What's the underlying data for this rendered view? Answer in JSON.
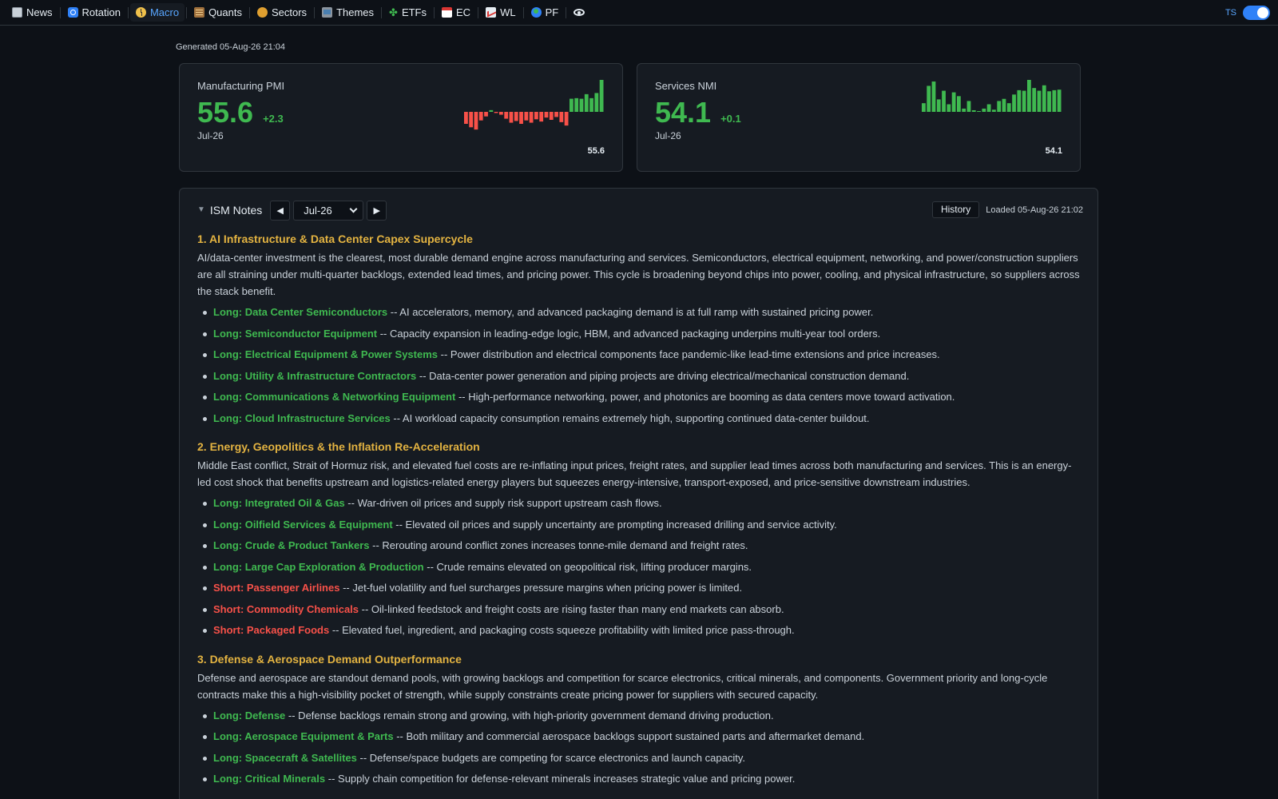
{
  "nav": {
    "items": [
      {
        "label": "News",
        "icon": "newspaper-icon"
      },
      {
        "label": "Rotation",
        "icon": "rotation-icon"
      },
      {
        "label": "Macro",
        "icon": "clock-icon",
        "active": true
      },
      {
        "label": "Quants",
        "icon": "abacus-icon"
      },
      {
        "label": "Sectors",
        "icon": "sectors-icon"
      },
      {
        "label": "Themes",
        "icon": "themes-icon"
      },
      {
        "label": "ETFs",
        "icon": "clover-icon"
      },
      {
        "label": "EC",
        "icon": "calendar-icon"
      },
      {
        "label": "WL",
        "icon": "chart-icon"
      },
      {
        "label": "PF",
        "icon": "globe-icon"
      }
    ],
    "ts_label": "TS"
  },
  "generated": "Generated 05-Aug-26 21:04",
  "cards": [
    {
      "title": "Manufacturing PMI",
      "value": "55.6",
      "change": "+2.3",
      "period": "Jul-26",
      "last": "55.6",
      "baseline": 50,
      "series": [
        47.9,
        47.3,
        46.9,
        48.5,
        49.2,
        50.3,
        49.8,
        49.5,
        48.8,
        48.1,
        48.4,
        47.9,
        48.5,
        48.1,
        48.7,
        48.3,
        49.0,
        48.6,
        49.1,
        48.2,
        47.6,
        52.3,
        52.4,
        52.3,
        53.1,
        52.4,
        53.3,
        55.6
      ],
      "colors": {
        "up": "#3fb950",
        "down": "#f85149"
      }
    },
    {
      "title": "Services NMI",
      "value": "54.1",
      "change": "+0.1",
      "period": "Jul-26",
      "last": "54.1",
      "baseline": 50,
      "series": [
        51.6,
        54.8,
        55.6,
        52.3,
        53.9,
        51.4,
        53.6,
        52.9,
        50.6,
        52.0,
        50.3,
        50.1,
        50.6,
        51.4,
        50.4,
        52.0,
        52.4,
        51.6,
        53.2,
        54.0,
        53.9,
        55.9,
        54.4,
        53.9,
        54.9,
        53.8,
        54.0,
        54.1
      ],
      "colors": {
        "up": "#3fb950",
        "down": "#f85149"
      }
    }
  ],
  "notes": {
    "title": "ISM Notes",
    "period": "Jul-26",
    "history_label": "History",
    "loaded": "Loaded 05-Aug-26 21:02",
    "sections": [
      {
        "title": "1. AI Infrastructure & Data Center Capex Supercycle",
        "desc": "AI/data-center investment is the clearest, most durable demand engine across manufacturing and services. Semiconductors, electrical equipment, networking, and power/construction suppliers are all straining under multi-quarter backlogs, extended lead times, and pricing power. This cycle is broadening beyond chips into power, cooling, and physical infrastructure, so suppliers across the stack benefit.",
        "items": [
          {
            "side": "long",
            "label": "Long: Data Center Semiconductors",
            "text": " -- AI accelerators, memory, and advanced packaging demand is at full ramp with sustained pricing power."
          },
          {
            "side": "long",
            "label": "Long: Semiconductor Equipment",
            "text": " -- Capacity expansion in leading-edge logic, HBM, and advanced packaging underpins multi-year tool orders."
          },
          {
            "side": "long",
            "label": "Long: Electrical Equipment & Power Systems",
            "text": " -- Power distribution and electrical components face pandemic-like lead-time extensions and price increases."
          },
          {
            "side": "long",
            "label": "Long: Utility & Infrastructure Contractors",
            "text": " -- Data-center power generation and piping projects are driving electrical/mechanical construction demand."
          },
          {
            "side": "long",
            "label": "Long: Communications & Networking Equipment",
            "text": " -- High-performance networking, power, and photonics are booming as data centers move toward activation."
          },
          {
            "side": "long",
            "label": "Long: Cloud Infrastructure Services",
            "text": " -- AI workload capacity consumption remains extremely high, supporting continued data-center buildout."
          }
        ]
      },
      {
        "title": "2. Energy, Geopolitics & the Inflation Re-Acceleration",
        "desc": "Middle East conflict, Strait of Hormuz risk, and elevated fuel costs are re-inflating input prices, freight rates, and supplier lead times across both manufacturing and services. This is an energy-led cost shock that benefits upstream and logistics-related energy players but squeezes energy-intensive, transport-exposed, and price-sensitive downstream industries.",
        "items": [
          {
            "side": "long",
            "label": "Long: Integrated Oil & Gas",
            "text": " -- War-driven oil prices and supply risk support upstream cash flows."
          },
          {
            "side": "long",
            "label": "Long: Oilfield Services & Equipment",
            "text": " -- Elevated oil prices and supply uncertainty are prompting increased drilling and service activity."
          },
          {
            "side": "long",
            "label": "Long: Crude & Product Tankers",
            "text": " -- Rerouting around conflict zones increases tonne-mile demand and freight rates."
          },
          {
            "side": "long",
            "label": "Long: Large Cap Exploration & Production",
            "text": " -- Crude remains elevated on geopolitical risk, lifting producer margins."
          },
          {
            "side": "short",
            "label": "Short: Passenger Airlines",
            "text": " -- Jet-fuel volatility and fuel surcharges pressure margins when pricing power is limited."
          },
          {
            "side": "short",
            "label": "Short: Commodity Chemicals",
            "text": " -- Oil-linked feedstock and freight costs are rising faster than many end markets can absorb."
          },
          {
            "side": "short",
            "label": "Short: Packaged Foods",
            "text": " -- Elevated fuel, ingredient, and packaging costs squeeze profitability with limited price pass-through."
          }
        ]
      },
      {
        "title": "3. Defense & Aerospace Demand Outperformance",
        "desc": "Defense and aerospace are standout demand pools, with growing backlogs and competition for scarce electronics, critical minerals, and components. Government priority and long-cycle contracts make this a high-visibility pocket of strength, while supply constraints create pricing power for suppliers with secured capacity.",
        "items": [
          {
            "side": "long",
            "label": "Long: Defense",
            "text": " -- Defense backlogs remain strong and growing, with high-priority government demand driving production."
          },
          {
            "side": "long",
            "label": "Long: Aerospace Equipment & Parts",
            "text": " -- Both military and commercial aerospace backlogs support sustained parts and aftermarket demand."
          },
          {
            "side": "long",
            "label": "Long: Spacecraft & Satellites",
            "text": " -- Defense/space budgets are competing for scarce electronics and launch capacity."
          },
          {
            "side": "long",
            "label": "Long: Critical Minerals",
            "text": " -- Supply chain competition for defense-relevant minerals increases strategic value and pricing power."
          }
        ]
      }
    ]
  }
}
